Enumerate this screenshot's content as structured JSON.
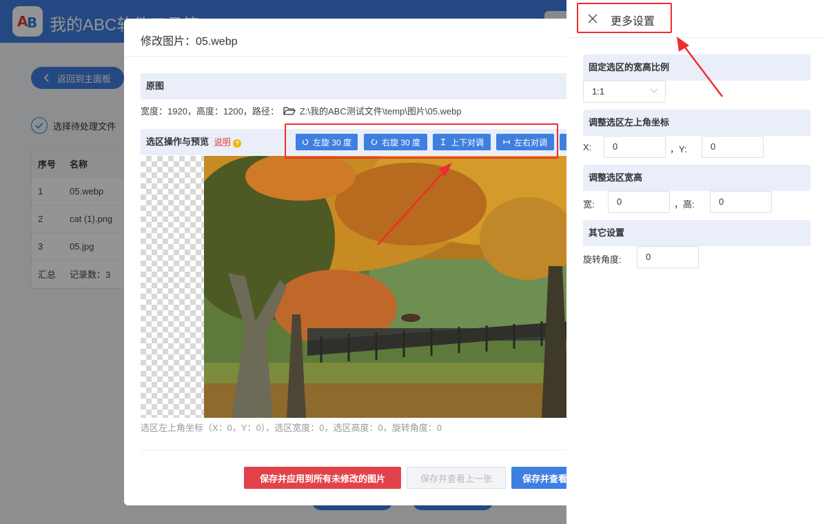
{
  "app": {
    "title": "我的ABC软件工具箱",
    "logo_a": "A",
    "logo_b": "B",
    "back_label": "返回到主面板",
    "step_label": "选择待处理文件",
    "table": {
      "headers": [
        "序号",
        "名称"
      ],
      "rows": [
        [
          "1",
          "05.webp"
        ],
        [
          "2",
          "cat (1).png"
        ],
        [
          "3",
          "05.jpg"
        ],
        [
          "汇总",
          "记录数：3"
        ]
      ]
    }
  },
  "dialog": {
    "title": "修改图片：05.webp",
    "original_section": "原图",
    "image_info": "宽度：1920，高度：1200，路径：",
    "image_path": "Z:\\我的ABC测试文件\\temp\\图片\\05.webp",
    "crop_section": "选区操作与预览",
    "help_link": "说明",
    "help_mark": "?",
    "tools": {
      "rotate_left": "左旋 30 度",
      "rotate_right": "右旋 30 度",
      "flip_vertical": "上下对调",
      "flip_horizontal": "左右对调"
    },
    "status": "选区左上角坐标（X：0，Y：0），选区宽度：0，选区高度：0，旋转角度：0",
    "buttons": {
      "apply_all": "保存并应用到所有未修改的图片",
      "save_prev": "保存并查看上一张",
      "save_next": "保存并查看"
    }
  },
  "drawer": {
    "title": "更多设置",
    "ratio_section": "固定选区的宽高比例",
    "ratio_value": "1:1",
    "coord_section": "调整选区左上角坐标",
    "x_label": "X:",
    "x_value": "0",
    "y_label": "，Y:",
    "y_value": "0",
    "size_section": "调整选区宽高",
    "w_label": "宽:",
    "w_value": "0",
    "h_label": "，高:",
    "h_value": "0",
    "other_section": "其它设置",
    "rotate_label": "旋转角度:",
    "rotate_value": "0"
  },
  "colors": {
    "primary": "#3f7fe0",
    "danger": "#e2434a",
    "annotation": "#f02c2c"
  }
}
